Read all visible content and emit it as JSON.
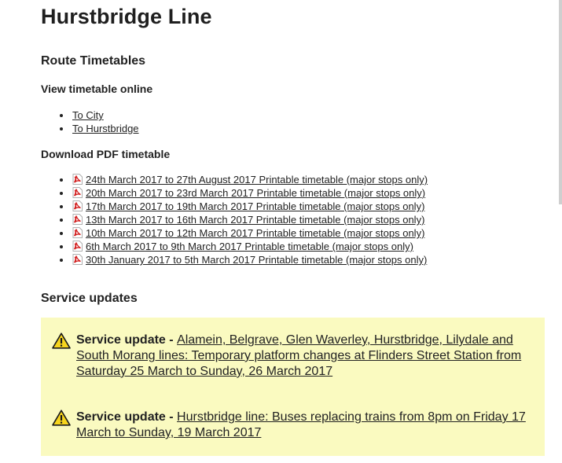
{
  "page": {
    "title": "Hurstbridge Line"
  },
  "route": {
    "heading": "Route Timetables",
    "online_heading": "View timetable online",
    "online_links": [
      {
        "label": "To City"
      },
      {
        "label": "To Hurstbridge"
      }
    ],
    "pdf_heading": "Download PDF timetable",
    "pdf_icon": "pdf-file-icon",
    "pdf_links": [
      {
        "label": "24th March 2017 to 27th August 2017 Printable timetable (major stops only)"
      },
      {
        "label": "20th March 2017 to 23rd March 2017 Printable timetable (major stops only)"
      },
      {
        "label": "17th March 2017 to 19th March 2017 Printable timetable (major stops only)"
      },
      {
        "label": "13th March 2017 to 16th March 2017 Printable timetable (major stops only)"
      },
      {
        "label": "10th March 2017 to 12th March 2017 Printable timetable (major stops only)"
      },
      {
        "label": "6th March 2017 to 9th March 2017 Printable timetable (major stops only)"
      },
      {
        "label": "30th January 2017 to 5th March 2017 Printable timetable (major stops only)"
      }
    ]
  },
  "updates": {
    "heading": "Service updates",
    "background_color": "#fafac0",
    "icon": "warning-icon",
    "items": [
      {
        "prefix": "Service update - ",
        "link": "Alamein, Belgrave, Glen Waverley, Hurstbridge, Lilydale and South Morang lines: Temporary platform changes at Flinders Street Station from Saturday 25 March to Sunday, 26 March 2017"
      },
      {
        "prefix": "Service update - ",
        "link": "Hurstbridge line: Buses replacing trains from 8pm on Friday 17 March to Sunday, 19 March 2017"
      }
    ]
  }
}
